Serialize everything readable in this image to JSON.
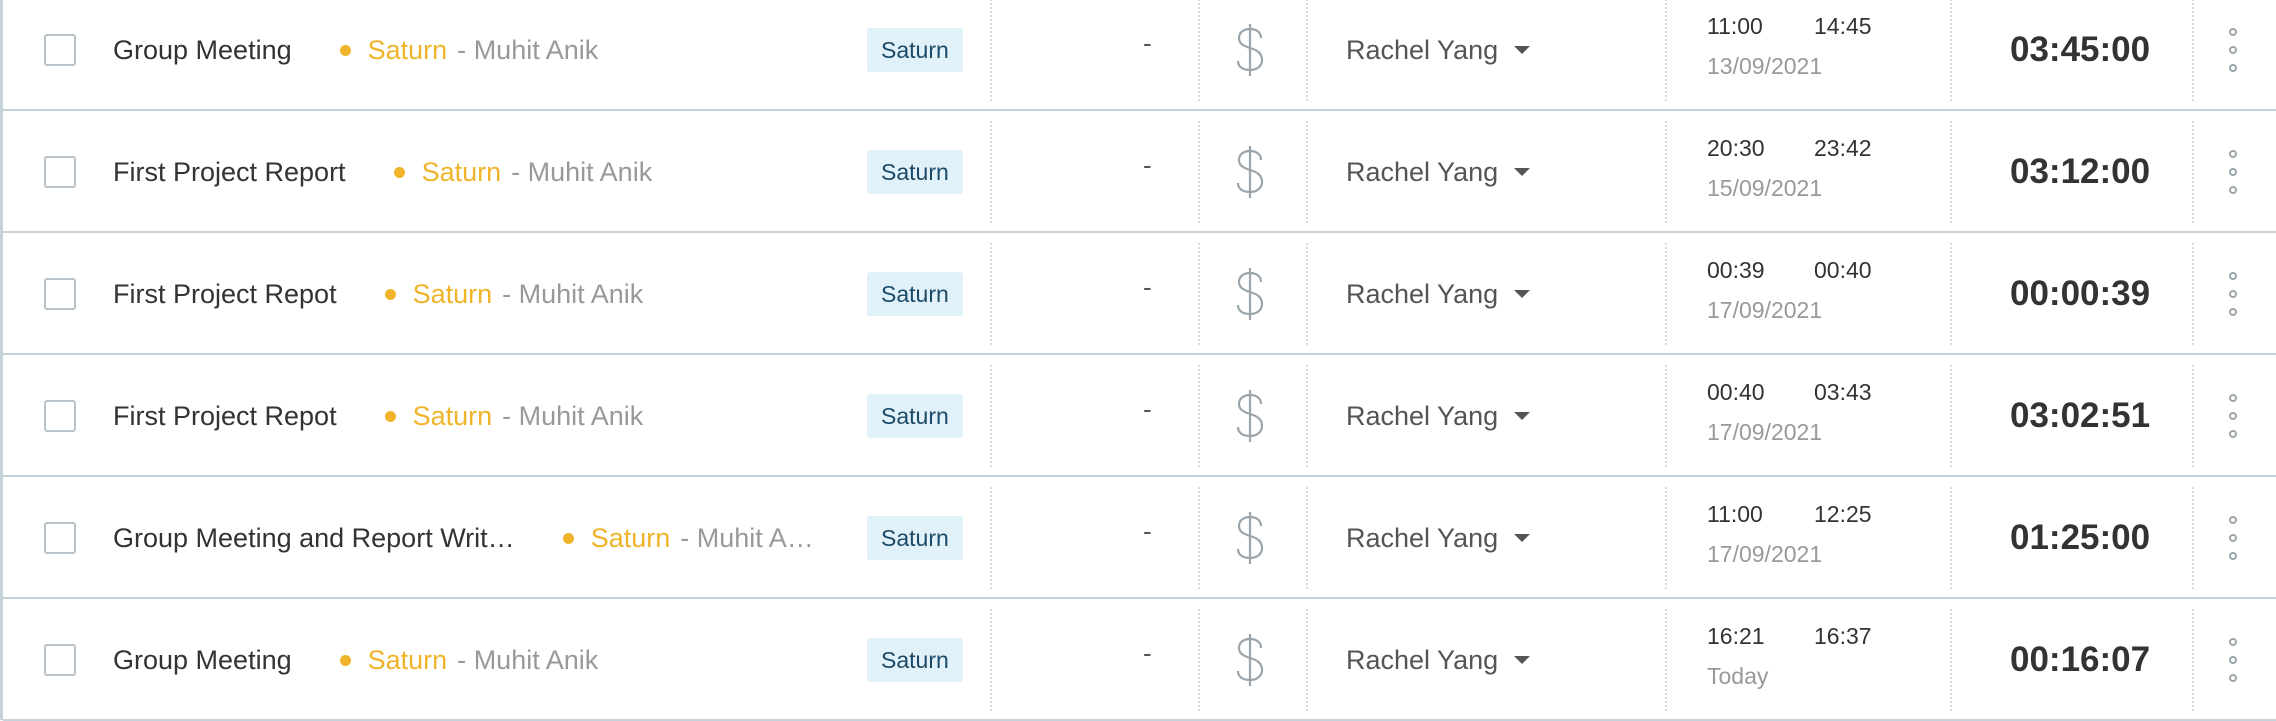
{
  "entries": [
    {
      "description": "Group Meeting",
      "project": "Saturn",
      "client_sep": "-",
      "client": "Muhit Anik",
      "tag": "Saturn",
      "task": "-",
      "billable_icon": "dollar-icon",
      "user": "Rachel Yang",
      "start": "11:00",
      "end": "14:45",
      "date": "13/09/2021",
      "duration": "03:45:00"
    },
    {
      "description": "First Project Report",
      "project": "Saturn",
      "client_sep": "-",
      "client": "Muhit Anik",
      "tag": "Saturn",
      "task": "-",
      "billable_icon": "dollar-icon",
      "user": "Rachel Yang",
      "start": "20:30",
      "end": "23:42",
      "date": "15/09/2021",
      "duration": "03:12:00"
    },
    {
      "description": "First Project Repot",
      "project": "Saturn",
      "client_sep": "-",
      "client": "Muhit Anik",
      "tag": "Saturn",
      "task": "-",
      "billable_icon": "dollar-icon",
      "user": "Rachel Yang",
      "start": "00:39",
      "end": "00:40",
      "date": "17/09/2021",
      "duration": "00:00:39"
    },
    {
      "description": "First Project Repot",
      "project": "Saturn",
      "client_sep": "-",
      "client": "Muhit Anik",
      "tag": "Saturn",
      "task": "-",
      "billable_icon": "dollar-icon",
      "user": "Rachel Yang",
      "start": "00:40",
      "end": "03:43",
      "date": "17/09/2021",
      "duration": "03:02:51"
    },
    {
      "description": "Group Meeting and Report Writ…",
      "project": "Saturn",
      "client_sep": "-",
      "client": "Muhit A…",
      "tag": "Saturn",
      "task": "-",
      "billable_icon": "dollar-icon",
      "user": "Rachel Yang",
      "start": "11:00",
      "end": "12:25",
      "date": "17/09/2021",
      "duration": "01:25:00"
    },
    {
      "description": "Group Meeting",
      "project": "Saturn",
      "client_sep": "-",
      "client": "Muhit Anik",
      "tag": "Saturn",
      "task": "-",
      "billable_icon": "dollar-icon",
      "user": "Rachel Yang",
      "start": "16:21",
      "end": "16:37",
      "date": "Today",
      "duration": "00:16:07"
    }
  ],
  "colors": {
    "project": "#f0b42a",
    "tag_bg": "#e1f1fa",
    "tag_text": "#1c4a66",
    "row_border": "#c6d2d9"
  }
}
